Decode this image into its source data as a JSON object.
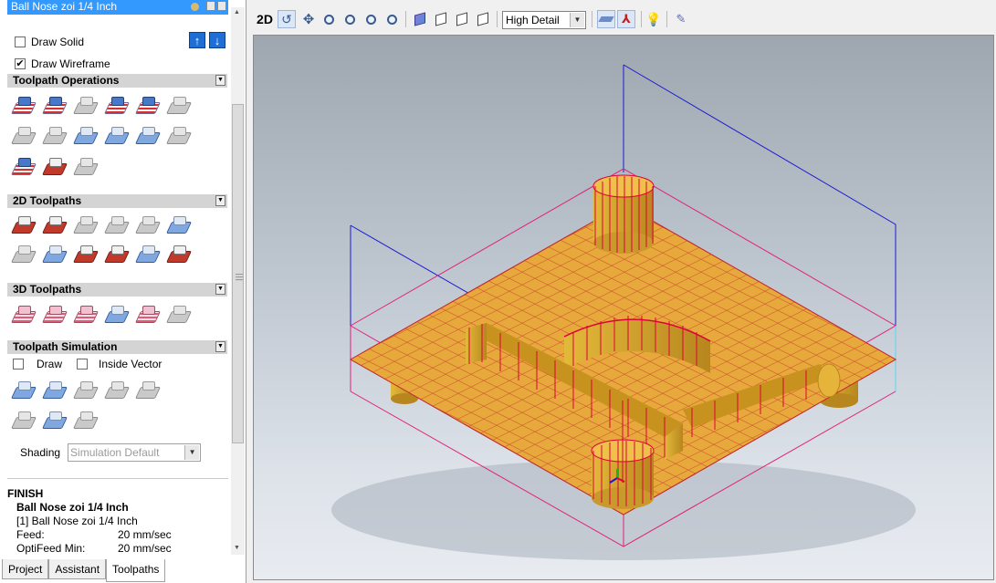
{
  "tool_header": {
    "title": "Ball Nose zoi 1/4 Inch"
  },
  "display": {
    "draw_solid_label": "Draw Solid",
    "draw_solid_checked": false,
    "draw_wireframe_label": "Draw Wireframe",
    "draw_wireframe_checked": true
  },
  "sections": {
    "toolpath_operations": "Toolpath Operations",
    "toolpaths_2d": "2D Toolpaths",
    "toolpaths_3d": "3D Toolpaths",
    "toolpath_simulation": "Toolpath Simulation"
  },
  "simulation": {
    "draw_label": "Draw",
    "inside_vector_label": "Inside Vector",
    "shading_label": "Shading",
    "shading_value": "Simulation Default"
  },
  "info": {
    "strategy": "FINISH",
    "tool_name": "Ball Nose zoi 1/4 Inch",
    "tool_ref": "[1] Ball Nose zoi 1/4 Inch",
    "feed_label": "Feed:",
    "feed_value": "20 mm/sec",
    "optifeed_label": "OptiFeed Min:",
    "optifeed_value": "20 mm/sec"
  },
  "tabs": [
    "Project",
    "Assistant",
    "Toolpaths"
  ],
  "active_tab": "Toolpaths",
  "toolbar": {
    "view_2d_label": "2D",
    "detail_level": "High Detail"
  },
  "colors": {
    "wire_red": "#e0003a",
    "material": "#e8a93c",
    "box_blue": "#1a1ad0",
    "box_pink": "#e0207a"
  }
}
